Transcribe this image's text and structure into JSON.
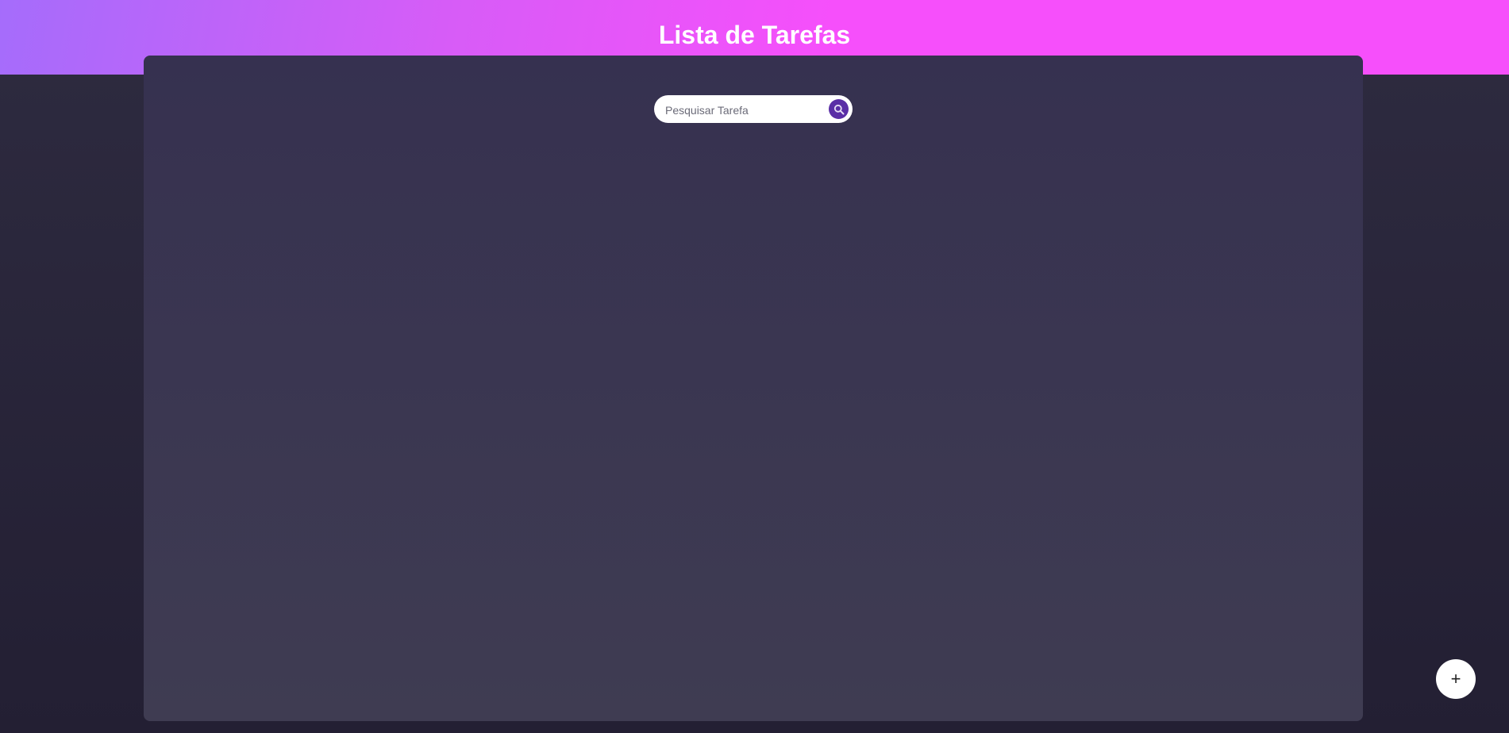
{
  "header": {
    "title": "Lista de Tarefas"
  },
  "search": {
    "placeholder": "Pesquisar Tarefa",
    "value": "",
    "icon": "search-icon"
  },
  "add_button": {
    "label": "+"
  },
  "colors": {
    "accent": "#f64ffb",
    "button": "#5a2ea6"
  }
}
